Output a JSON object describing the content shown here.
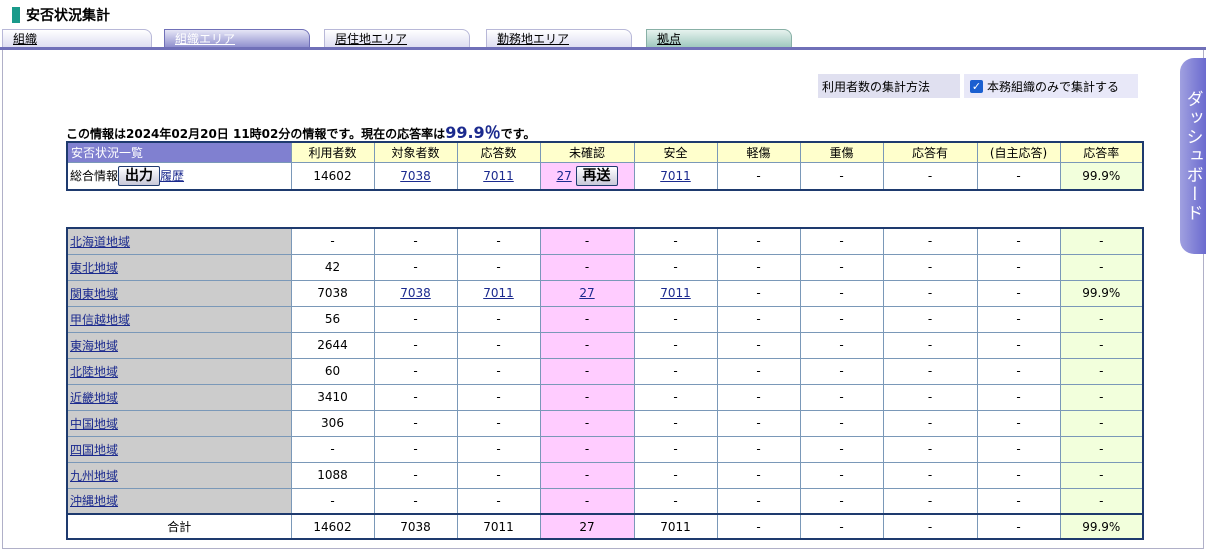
{
  "title": "安否状況集計",
  "tabs": [
    "組織",
    "組織エリア",
    "居住地エリア",
    "勤務地エリア",
    "拠点"
  ],
  "aggregation": {
    "label": "利用者数の集計方法",
    "option": "本務組織のみで集計する",
    "checked": true
  },
  "dashboard_label": "ダッシュボード",
  "info": {
    "prefix": "この情報は2024年02月20日 11時02分の情報です。現在の応答率は",
    "rate": "99.9％",
    "suffix": "です。"
  },
  "summary": {
    "headers": [
      "安否状況一覧",
      "利用者数",
      "対象者数",
      "応答数",
      "未確認",
      "安全",
      "軽傷",
      "重傷",
      "応答有",
      "(自主応答)",
      "応答率"
    ],
    "row": {
      "label": "総合情報",
      "output_button": "出力",
      "history_link": "履歴",
      "users": "14602",
      "targets": "7038",
      "responses": "7011",
      "unconfirmed": "27",
      "resend_button": "再送",
      "safe": "7011",
      "minor": "-",
      "serious": "-",
      "responded": "-",
      "voluntary": "-",
      "rate": "99.9%"
    }
  },
  "regions": [
    {
      "name": "北海道地域",
      "users": "-",
      "targets": "-",
      "responses": "-",
      "unconfirmed": "-",
      "safe": "-",
      "minor": "-",
      "serious": "-",
      "responded": "-",
      "voluntary": "-",
      "rate": "-"
    },
    {
      "name": "東北地域",
      "users": "42",
      "targets": "-",
      "responses": "-",
      "unconfirmed": "-",
      "safe": "-",
      "minor": "-",
      "serious": "-",
      "responded": "-",
      "voluntary": "-",
      "rate": "-"
    },
    {
      "name": "関東地域",
      "users": "7038",
      "targets": "7038",
      "responses": "7011",
      "unconfirmed": "27",
      "safe": "7011",
      "minor": "-",
      "serious": "-",
      "responded": "-",
      "voluntary": "-",
      "rate": "99.9%"
    },
    {
      "name": "甲信越地域",
      "users": "56",
      "targets": "-",
      "responses": "-",
      "unconfirmed": "-",
      "safe": "-",
      "minor": "-",
      "serious": "-",
      "responded": "-",
      "voluntary": "-",
      "rate": "-"
    },
    {
      "name": "東海地域",
      "users": "2644",
      "targets": "-",
      "responses": "-",
      "unconfirmed": "-",
      "safe": "-",
      "minor": "-",
      "serious": "-",
      "responded": "-",
      "voluntary": "-",
      "rate": "-"
    },
    {
      "name": "北陸地域",
      "users": "60",
      "targets": "-",
      "responses": "-",
      "unconfirmed": "-",
      "safe": "-",
      "minor": "-",
      "serious": "-",
      "responded": "-",
      "voluntary": "-",
      "rate": "-"
    },
    {
      "name": "近畿地域",
      "users": "3410",
      "targets": "-",
      "responses": "-",
      "unconfirmed": "-",
      "safe": "-",
      "minor": "-",
      "serious": "-",
      "responded": "-",
      "voluntary": "-",
      "rate": "-"
    },
    {
      "name": "中国地域",
      "users": "306",
      "targets": "-",
      "responses": "-",
      "unconfirmed": "-",
      "safe": "-",
      "minor": "-",
      "serious": "-",
      "responded": "-",
      "voluntary": "-",
      "rate": "-"
    },
    {
      "name": "四国地域",
      "users": "-",
      "targets": "-",
      "responses": "-",
      "unconfirmed": "-",
      "safe": "-",
      "minor": "-",
      "serious": "-",
      "responded": "-",
      "voluntary": "-",
      "rate": "-"
    },
    {
      "name": "九州地域",
      "users": "1088",
      "targets": "-",
      "responses": "-",
      "unconfirmed": "-",
      "safe": "-",
      "minor": "-",
      "serious": "-",
      "responded": "-",
      "voluntary": "-",
      "rate": "-"
    },
    {
      "name": "沖縄地域",
      "users": "-",
      "targets": "-",
      "responses": "-",
      "unconfirmed": "-",
      "safe": "-",
      "minor": "-",
      "serious": "-",
      "responded": "-",
      "voluntary": "-",
      "rate": "-"
    }
  ],
  "total": {
    "label": "合計",
    "users": "14602",
    "targets": "7038",
    "responses": "7011",
    "unconfirmed": "27",
    "safe": "7011",
    "minor": "-",
    "serious": "-",
    "responded": "-",
    "voluntary": "-",
    "rate": "99.9%"
  },
  "colors": {
    "accent": "#7070b8",
    "header_bg": "#ffffcc",
    "unconfirmed_bg": "#ffccff",
    "rate_bg": "#f2ffdc",
    "link": "#1b2a8e"
  }
}
